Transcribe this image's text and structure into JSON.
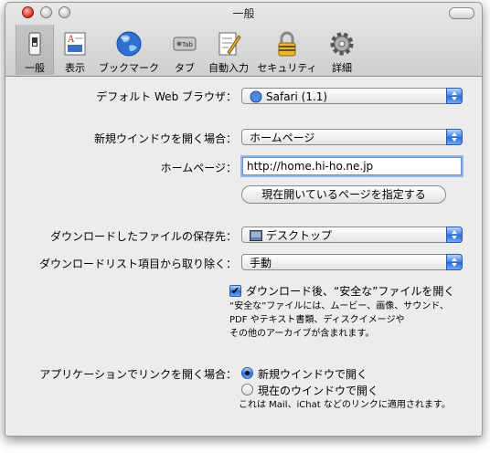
{
  "window": {
    "title": "一般"
  },
  "toolbar": {
    "items": [
      {
        "label": "一般",
        "icon": "switch-icon"
      },
      {
        "label": "表示",
        "icon": "appearance-icon"
      },
      {
        "label": "ブックマーク",
        "icon": "globe-icon"
      },
      {
        "label": "タブ",
        "icon": "tab-icon"
      },
      {
        "label": "自動入力",
        "icon": "pencil-form-icon"
      },
      {
        "label": "セキュリティ",
        "icon": "lock-icon"
      },
      {
        "label": "詳細",
        "icon": "gear-icon"
      }
    ],
    "tab_icon_text": "Tab"
  },
  "form": {
    "default_browser": {
      "label": "デフォルト Web ブラウザ：",
      "value": "Safari (1.1)"
    },
    "new_window": {
      "label": "新規ウインドウを開く場合：",
      "value": "ホームページ"
    },
    "homepage": {
      "label": "ホームページ：",
      "value": "http://home.hi-ho.ne.jp"
    },
    "set_current_button": "現在開いているページを指定する",
    "save_location": {
      "label": "ダウンロードしたファイルの保存先：",
      "value": "デスクトップ"
    },
    "remove_items": {
      "label": "ダウンロードリスト項目から取り除く：",
      "value": "手動"
    },
    "open_safe": {
      "label": "ダウンロード後、“安全な”ファイルを開く",
      "checked": true,
      "desc_1": "“安全な”ファイルには、ムービー、画像、サウンド、",
      "desc_2": "PDF やテキスト書類、ディスクイメージや",
      "desc_3": "その他のアーカイブが含まれます。"
    },
    "open_links": {
      "label": "アプリケーションでリンクを開く場合：",
      "option_new_window": "新規ウインドウで開く",
      "option_current_window": "現在のウインドウで開く",
      "note": "これは Mail、iChat などのリンクに適用されます。"
    }
  },
  "colors": {
    "accent": "#3d7fe0",
    "window_bg": "#ececec"
  }
}
